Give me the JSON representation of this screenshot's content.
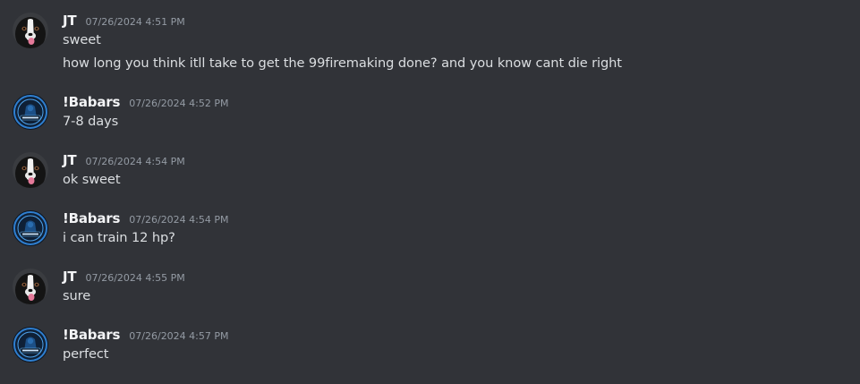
{
  "colors": {
    "background": "#313338",
    "username": "#f2f3f5",
    "timestamp": "#949ba4",
    "message_text": "#dbdee1"
  },
  "messages": [
    {
      "author": "JT",
      "avatar_icon": "dog-avatar-icon",
      "timestamp": "07/26/2024 4:51 PM",
      "lines": [
        "sweet",
        "how long you think itll take to get the 99firemaking done? and you know cant die right"
      ]
    },
    {
      "author": "!Babars",
      "avatar_icon": "clan-logo-avatar-icon",
      "timestamp": "07/26/2024 4:52 PM",
      "lines": [
        "7-8 days"
      ]
    },
    {
      "author": "JT",
      "avatar_icon": "dog-avatar-icon",
      "timestamp": "07/26/2024 4:54 PM",
      "lines": [
        "ok sweet"
      ]
    },
    {
      "author": "!Babars",
      "avatar_icon": "clan-logo-avatar-icon",
      "timestamp": "07/26/2024 4:54 PM",
      "lines": [
        "i can train 12 hp?"
      ]
    },
    {
      "author": "JT",
      "avatar_icon": "dog-avatar-icon",
      "timestamp": "07/26/2024 4:55 PM",
      "lines": [
        "sure"
      ]
    },
    {
      "author": "!Babars",
      "avatar_icon": "clan-logo-avatar-icon",
      "timestamp": "07/26/2024 4:57 PM",
      "lines": [
        "perfect"
      ]
    }
  ]
}
